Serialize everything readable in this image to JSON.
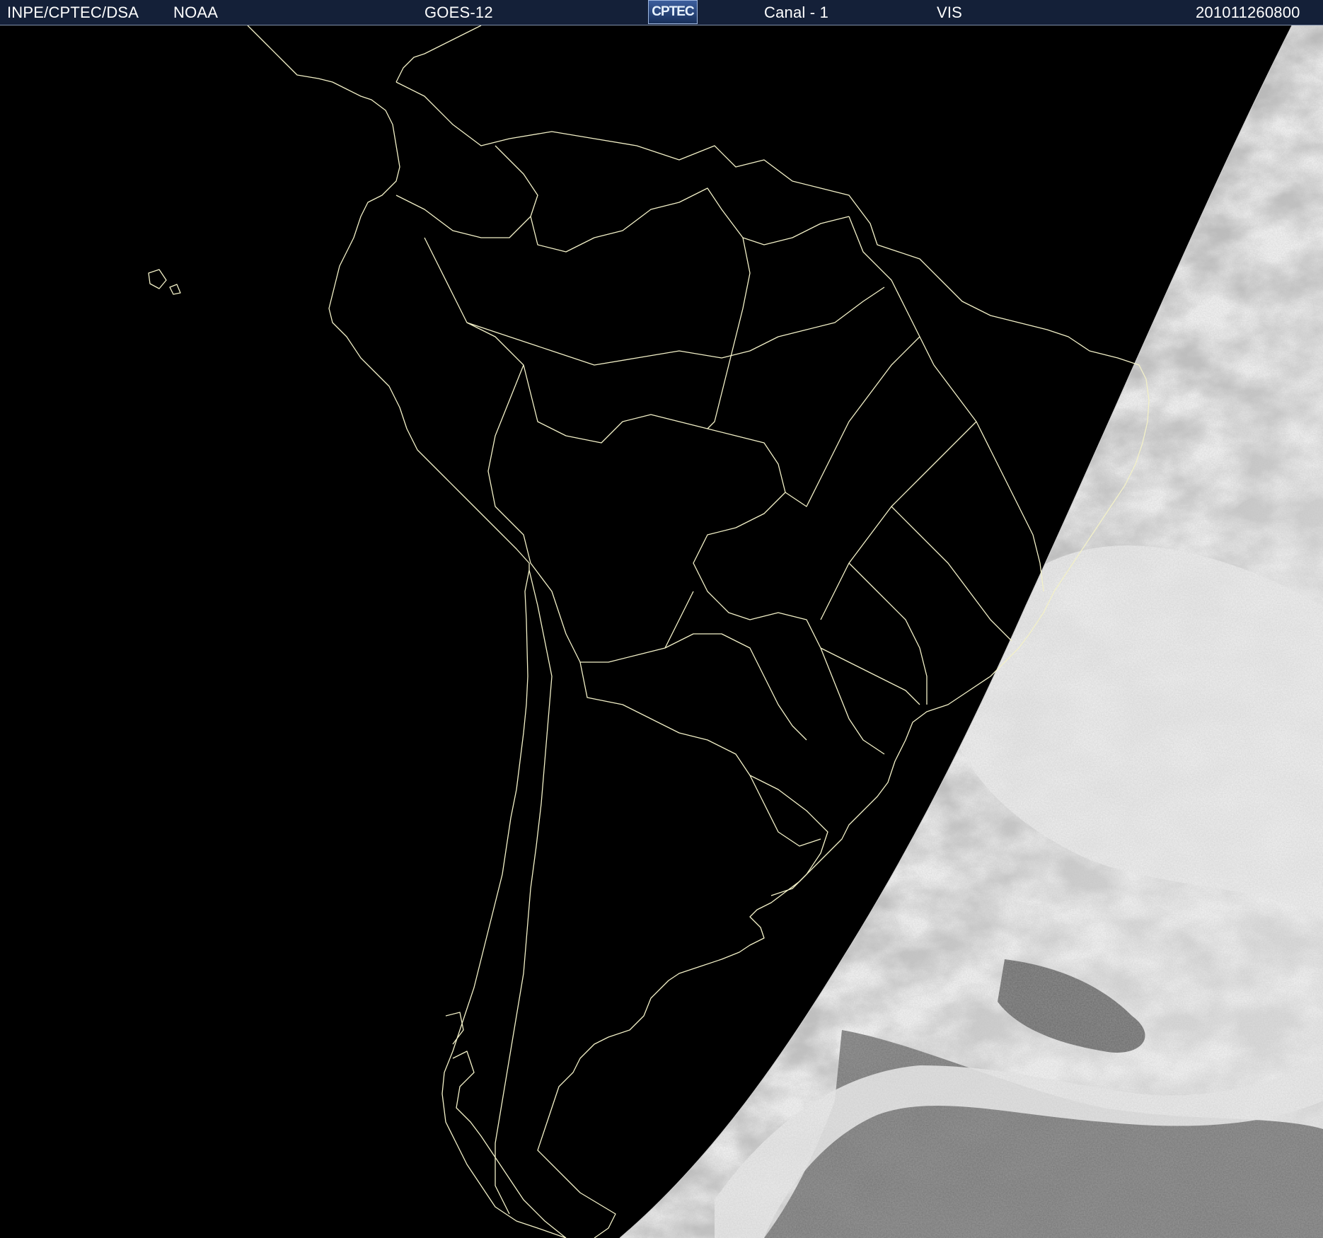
{
  "header": {
    "organization": "INPE/CPTEC/DSA",
    "agency": "NOAA",
    "satellite": "GOES-12",
    "logo_text": "CPTEC",
    "channel": "Canal - 1",
    "band": "VIS",
    "timestamp": "201011260800"
  },
  "image": {
    "map_region": "South America",
    "colors": {
      "header_background": "#142038",
      "coastline": "#f3f1c8",
      "night_side": "#000000",
      "cloud_bright": "#f2f2f2",
      "cloud_mid": "#9b9b9b",
      "cloud_dark": "#5a5a5a"
    }
  }
}
